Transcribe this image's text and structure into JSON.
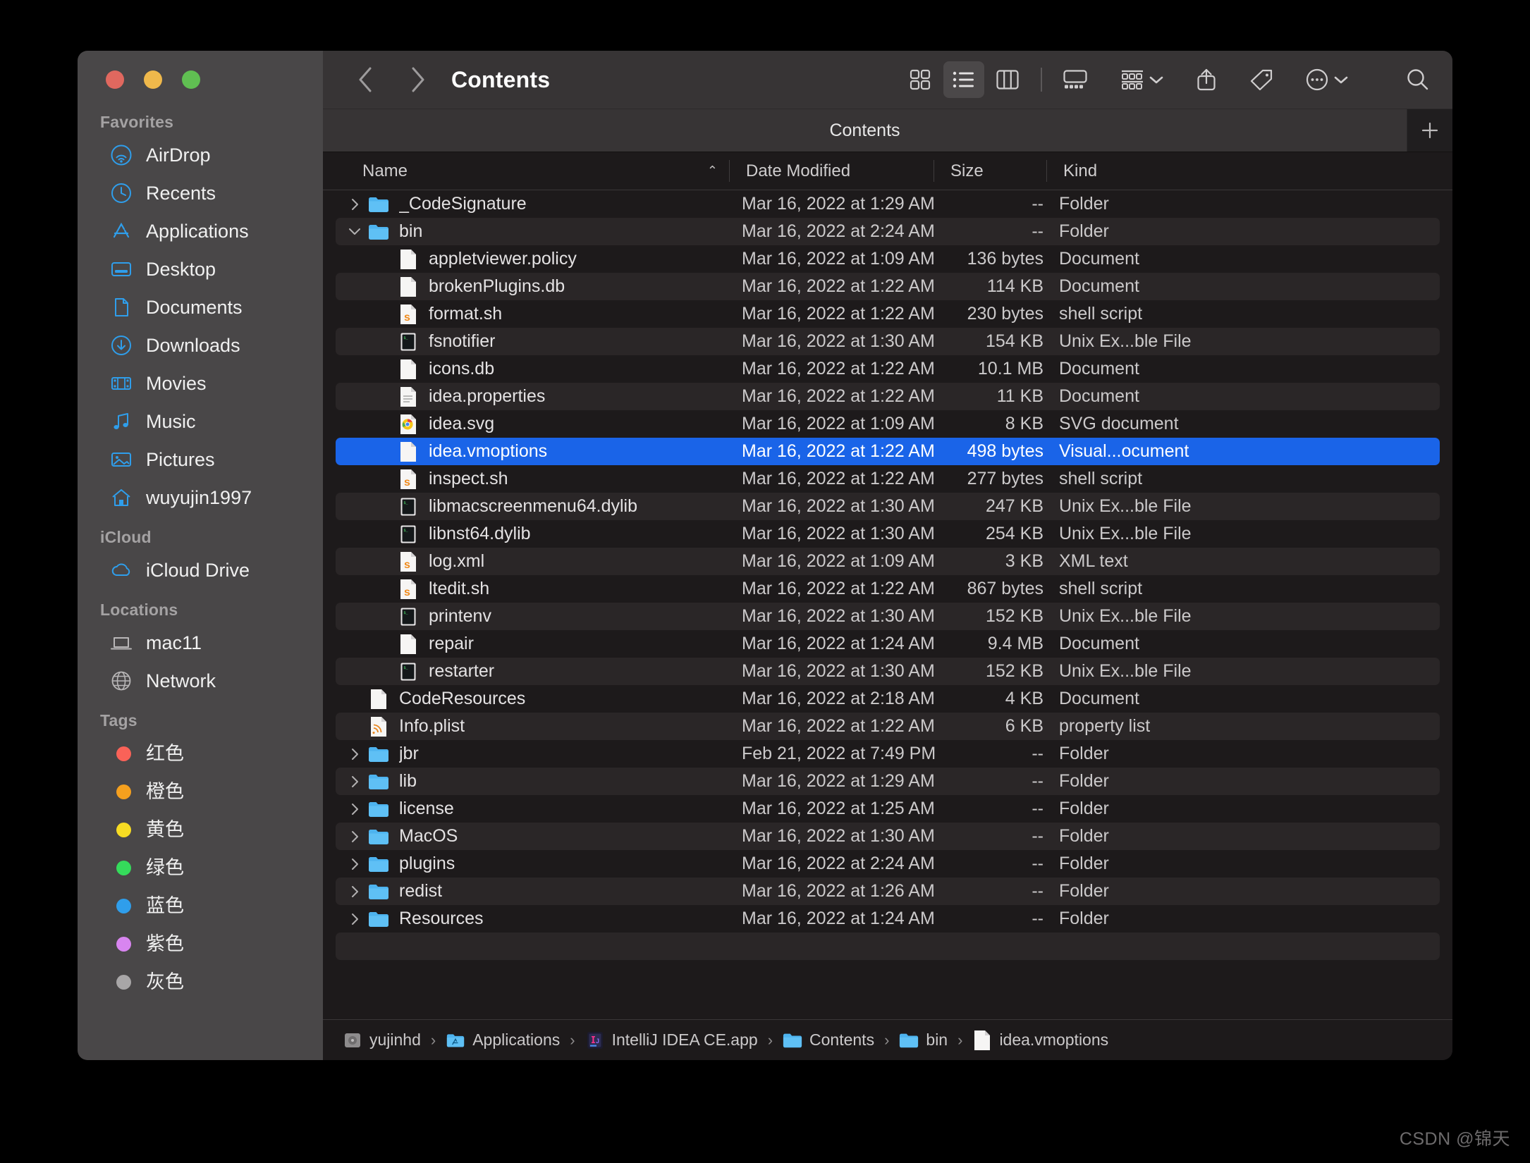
{
  "window": {
    "traffic_lights": [
      "close",
      "minimize",
      "zoom"
    ]
  },
  "toolbar": {
    "back_label": "Back",
    "forward_label": "Forward",
    "title": "Contents",
    "view_icon_label": "Icon View",
    "view_list_label": "List View",
    "view_column_label": "Column View",
    "view_gallery_label": "Gallery View",
    "group_label": "Group By",
    "share_label": "Share",
    "tag_label": "Tag",
    "more_label": "More Actions",
    "search_label": "Search"
  },
  "tabbar": {
    "tabs": [
      {
        "label": "Contents",
        "active": true
      }
    ],
    "add_label": "+"
  },
  "columns": {
    "name": "Name",
    "date_modified": "Date Modified",
    "size": "Size",
    "kind": "Kind",
    "sort_caret": "⌃"
  },
  "sidebar": {
    "sections": [
      {
        "title": "Favorites",
        "items": [
          {
            "label": "AirDrop",
            "icon": "airdrop-icon"
          },
          {
            "label": "Recents",
            "icon": "clock-icon"
          },
          {
            "label": "Applications",
            "icon": "applications-icon"
          },
          {
            "label": "Desktop",
            "icon": "desktop-icon"
          },
          {
            "label": "Documents",
            "icon": "document-icon"
          },
          {
            "label": "Downloads",
            "icon": "download-icon"
          },
          {
            "label": "Movies",
            "icon": "movies-icon"
          },
          {
            "label": "Music",
            "icon": "music-icon"
          },
          {
            "label": "Pictures",
            "icon": "pictures-icon"
          },
          {
            "label": "wuyujin1997",
            "icon": "home-icon"
          }
        ]
      },
      {
        "title": "iCloud",
        "items": [
          {
            "label": "iCloud Drive",
            "icon": "cloud-icon"
          }
        ]
      },
      {
        "title": "Locations",
        "items": [
          {
            "label": "mac11",
            "icon": "laptop-icon"
          },
          {
            "label": "Network",
            "icon": "globe-icon"
          }
        ]
      },
      {
        "title": "Tags",
        "items": [
          {
            "label": "红色",
            "icon": "tag-dot",
            "color": "#fa6258"
          },
          {
            "label": "橙色",
            "icon": "tag-dot",
            "color": "#f5a01e"
          },
          {
            "label": "黄色",
            "icon": "tag-dot",
            "color": "#f7dc23"
          },
          {
            "label": "绿色",
            "icon": "tag-dot",
            "color": "#35db5b"
          },
          {
            "label": "蓝色",
            "icon": "tag-dot",
            "color": "#2f9eeb"
          },
          {
            "label": "紫色",
            "icon": "tag-dot",
            "color": "#d885f0"
          },
          {
            "label": "灰色",
            "icon": "tag-dot",
            "color": "#a8a6a7"
          }
        ]
      }
    ]
  },
  "files": [
    {
      "name": "_CodeSignature",
      "date": "Mar 16, 2022 at 1:29 AM",
      "size": "--",
      "kind": "Folder",
      "icon": "folder-icon",
      "twisty": "collapsed",
      "depth": 0,
      "selected": false
    },
    {
      "name": "bin",
      "date": "Mar 16, 2022 at 2:24 AM",
      "size": "--",
      "kind": "Folder",
      "icon": "folder-icon",
      "twisty": "expanded",
      "depth": 0,
      "selected": false
    },
    {
      "name": "appletviewer.policy",
      "date": "Mar 16, 2022 at 1:09 AM",
      "size": "136 bytes",
      "kind": "Document",
      "icon": "blank-doc-icon",
      "twisty": "none",
      "depth": 1,
      "selected": false
    },
    {
      "name": "brokenPlugins.db",
      "date": "Mar 16, 2022 at 1:22 AM",
      "size": "114 KB",
      "kind": "Document",
      "icon": "blank-doc-icon",
      "twisty": "none",
      "depth": 1,
      "selected": false
    },
    {
      "name": "format.sh",
      "date": "Mar 16, 2022 at 1:22 AM",
      "size": "230 bytes",
      "kind": "shell script",
      "icon": "shell-script-icon",
      "twisty": "none",
      "depth": 1,
      "selected": false
    },
    {
      "name": "fsnotifier",
      "date": "Mar 16, 2022 at 1:30 AM",
      "size": "154 KB",
      "kind": "Unix Ex...ble File",
      "icon": "unix-exec-icon",
      "twisty": "none",
      "depth": 1,
      "selected": false
    },
    {
      "name": "icons.db",
      "date": "Mar 16, 2022 at 1:22 AM",
      "size": "10.1 MB",
      "kind": "Document",
      "icon": "blank-doc-icon",
      "twisty": "none",
      "depth": 1,
      "selected": false
    },
    {
      "name": "idea.properties",
      "date": "Mar 16, 2022 at 1:22 AM",
      "size": "11 KB",
      "kind": "Document",
      "icon": "text-doc-icon",
      "twisty": "none",
      "depth": 1,
      "selected": false
    },
    {
      "name": "idea.svg",
      "date": "Mar 16, 2022 at 1:09 AM",
      "size": "8 KB",
      "kind": "SVG document",
      "icon": "chrome-doc-icon",
      "twisty": "none",
      "depth": 1,
      "selected": false
    },
    {
      "name": "idea.vmoptions",
      "date": "Mar 16, 2022 at 1:22 AM",
      "size": "498 bytes",
      "kind": "Visual...ocument",
      "icon": "blank-doc-icon",
      "twisty": "none",
      "depth": 1,
      "selected": true
    },
    {
      "name": "inspect.sh",
      "date": "Mar 16, 2022 at 1:22 AM",
      "size": "277 bytes",
      "kind": "shell script",
      "icon": "shell-script-icon",
      "twisty": "none",
      "depth": 1,
      "selected": false
    },
    {
      "name": "libmacscreenmenu64.dylib",
      "date": "Mar 16, 2022 at 1:30 AM",
      "size": "247 KB",
      "kind": "Unix Ex...ble File",
      "icon": "unix-exec-icon",
      "twisty": "none",
      "depth": 1,
      "selected": false
    },
    {
      "name": "libnst64.dylib",
      "date": "Mar 16, 2022 at 1:30 AM",
      "size": "254 KB",
      "kind": "Unix Ex...ble File",
      "icon": "unix-exec-icon",
      "twisty": "none",
      "depth": 1,
      "selected": false
    },
    {
      "name": "log.xml",
      "date": "Mar 16, 2022 at 1:09 AM",
      "size": "3 KB",
      "kind": "XML text",
      "icon": "shell-script-icon",
      "twisty": "none",
      "depth": 1,
      "selected": false
    },
    {
      "name": "ltedit.sh",
      "date": "Mar 16, 2022 at 1:22 AM",
      "size": "867 bytes",
      "kind": "shell script",
      "icon": "shell-script-icon",
      "twisty": "none",
      "depth": 1,
      "selected": false
    },
    {
      "name": "printenv",
      "date": "Mar 16, 2022 at 1:30 AM",
      "size": "152 KB",
      "kind": "Unix Ex...ble File",
      "icon": "unix-exec-icon",
      "twisty": "none",
      "depth": 1,
      "selected": false
    },
    {
      "name": "repair",
      "date": "Mar 16, 2022 at 1:24 AM",
      "size": "9.4 MB",
      "kind": "Document",
      "icon": "blank-doc-icon",
      "twisty": "none",
      "depth": 1,
      "selected": false
    },
    {
      "name": "restarter",
      "date": "Mar 16, 2022 at 1:30 AM",
      "size": "152 KB",
      "kind": "Unix Ex...ble File",
      "icon": "unix-exec-icon",
      "twisty": "none",
      "depth": 1,
      "selected": false
    },
    {
      "name": "CodeResources",
      "date": "Mar 16, 2022 at 2:18 AM",
      "size": "4 KB",
      "kind": "Document",
      "icon": "blank-doc-icon",
      "twisty": "none",
      "depth": 0,
      "selected": false
    },
    {
      "name": "Info.plist",
      "date": "Mar 16, 2022 at 1:22 AM",
      "size": "6 KB",
      "kind": "property list",
      "icon": "plist-icon",
      "twisty": "none",
      "depth": 0,
      "selected": false
    },
    {
      "name": "jbr",
      "date": "Feb 21, 2022 at 7:49 PM",
      "size": "--",
      "kind": "Folder",
      "icon": "folder-icon",
      "twisty": "collapsed",
      "depth": 0,
      "selected": false
    },
    {
      "name": "lib",
      "date": "Mar 16, 2022 at 1:29 AM",
      "size": "--",
      "kind": "Folder",
      "icon": "folder-icon",
      "twisty": "collapsed",
      "depth": 0,
      "selected": false
    },
    {
      "name": "license",
      "date": "Mar 16, 2022 at 1:25 AM",
      "size": "--",
      "kind": "Folder",
      "icon": "folder-icon",
      "twisty": "collapsed",
      "depth": 0,
      "selected": false
    },
    {
      "name": "MacOS",
      "date": "Mar 16, 2022 at 1:30 AM",
      "size": "--",
      "kind": "Folder",
      "icon": "folder-icon",
      "twisty": "collapsed",
      "depth": 0,
      "selected": false
    },
    {
      "name": "plugins",
      "date": "Mar 16, 2022 at 2:24 AM",
      "size": "--",
      "kind": "Folder",
      "icon": "folder-icon",
      "twisty": "collapsed",
      "depth": 0,
      "selected": false
    },
    {
      "name": "redist",
      "date": "Mar 16, 2022 at 1:26 AM",
      "size": "--",
      "kind": "Folder",
      "icon": "folder-icon",
      "twisty": "collapsed",
      "depth": 0,
      "selected": false
    },
    {
      "name": "Resources",
      "date": "Mar 16, 2022 at 1:24 AM",
      "size": "--",
      "kind": "Folder",
      "icon": "folder-icon",
      "twisty": "collapsed",
      "depth": 0,
      "selected": false
    }
  ],
  "pathbar": [
    {
      "label": "yujinhd",
      "icon": "disk-icon"
    },
    {
      "label": "Applications",
      "icon": "applications-folder-icon"
    },
    {
      "label": "IntelliJ IDEA CE.app",
      "icon": "intellij-icon"
    },
    {
      "label": "Contents",
      "icon": "folder-icon"
    },
    {
      "label": "bin",
      "icon": "folder-icon"
    },
    {
      "label": "idea.vmoptions",
      "icon": "blank-doc-icon"
    }
  ],
  "pathbar_separator": "›",
  "watermark": "CSDN @锦天",
  "colors": {
    "selection_blue": "#1a64e8",
    "sidebar_bg": "#494748",
    "main_bg": "#1d1a1b",
    "toolbar_bg": "#373435",
    "row_alt": "#2a2627",
    "accent_icon": "#2f9eeb"
  }
}
